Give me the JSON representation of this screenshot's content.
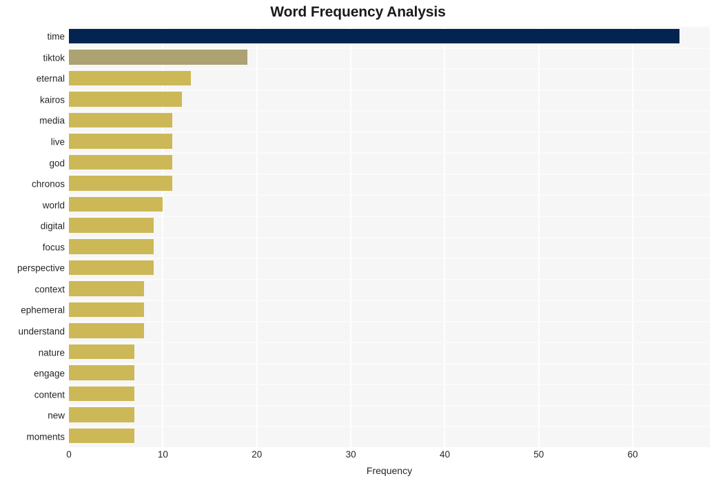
{
  "chart_data": {
    "type": "bar",
    "orientation": "horizontal",
    "title": "Word Frequency Analysis",
    "xlabel": "Frequency",
    "ylabel": "",
    "categories": [
      "time",
      "tiktok",
      "eternal",
      "kairos",
      "media",
      "live",
      "god",
      "chronos",
      "world",
      "digital",
      "focus",
      "perspective",
      "context",
      "ephemeral",
      "understand",
      "nature",
      "engage",
      "content",
      "new",
      "moments"
    ],
    "values": [
      65,
      19,
      13,
      12,
      11,
      11,
      11,
      11,
      10,
      9,
      9,
      9,
      8,
      8,
      8,
      7,
      7,
      7,
      7,
      7
    ],
    "xlim": [
      0,
      68.2
    ],
    "xticks": [
      0,
      10,
      20,
      30,
      40,
      50,
      60
    ],
    "xtick_labels": [
      "0",
      "10",
      "20",
      "30",
      "40",
      "50",
      "60"
    ],
    "grid": true,
    "grid_axis": "x",
    "legend": false,
    "bar_colors": [
      "#032451",
      "#aca272",
      "#cdb857",
      "#cdb857",
      "#cdb857",
      "#cdb857",
      "#cdb857",
      "#cdb857",
      "#cdb857",
      "#cdb857",
      "#cdb857",
      "#cdb857",
      "#cdb857",
      "#cdb857",
      "#cdb857",
      "#cdb857",
      "#cdb857",
      "#cdb857",
      "#cdb857",
      "#cdb857"
    ]
  },
  "style": {
    "figure_background": "#ffffff",
    "plot_background": "#f6f6f6",
    "gridline_color": "#ffffff",
    "text_color": "#262626",
    "title_color": "#1a1a1a",
    "accent_primary": "#032451",
    "accent_secondary": "#aca272",
    "accent_default": "#cdb857"
  }
}
